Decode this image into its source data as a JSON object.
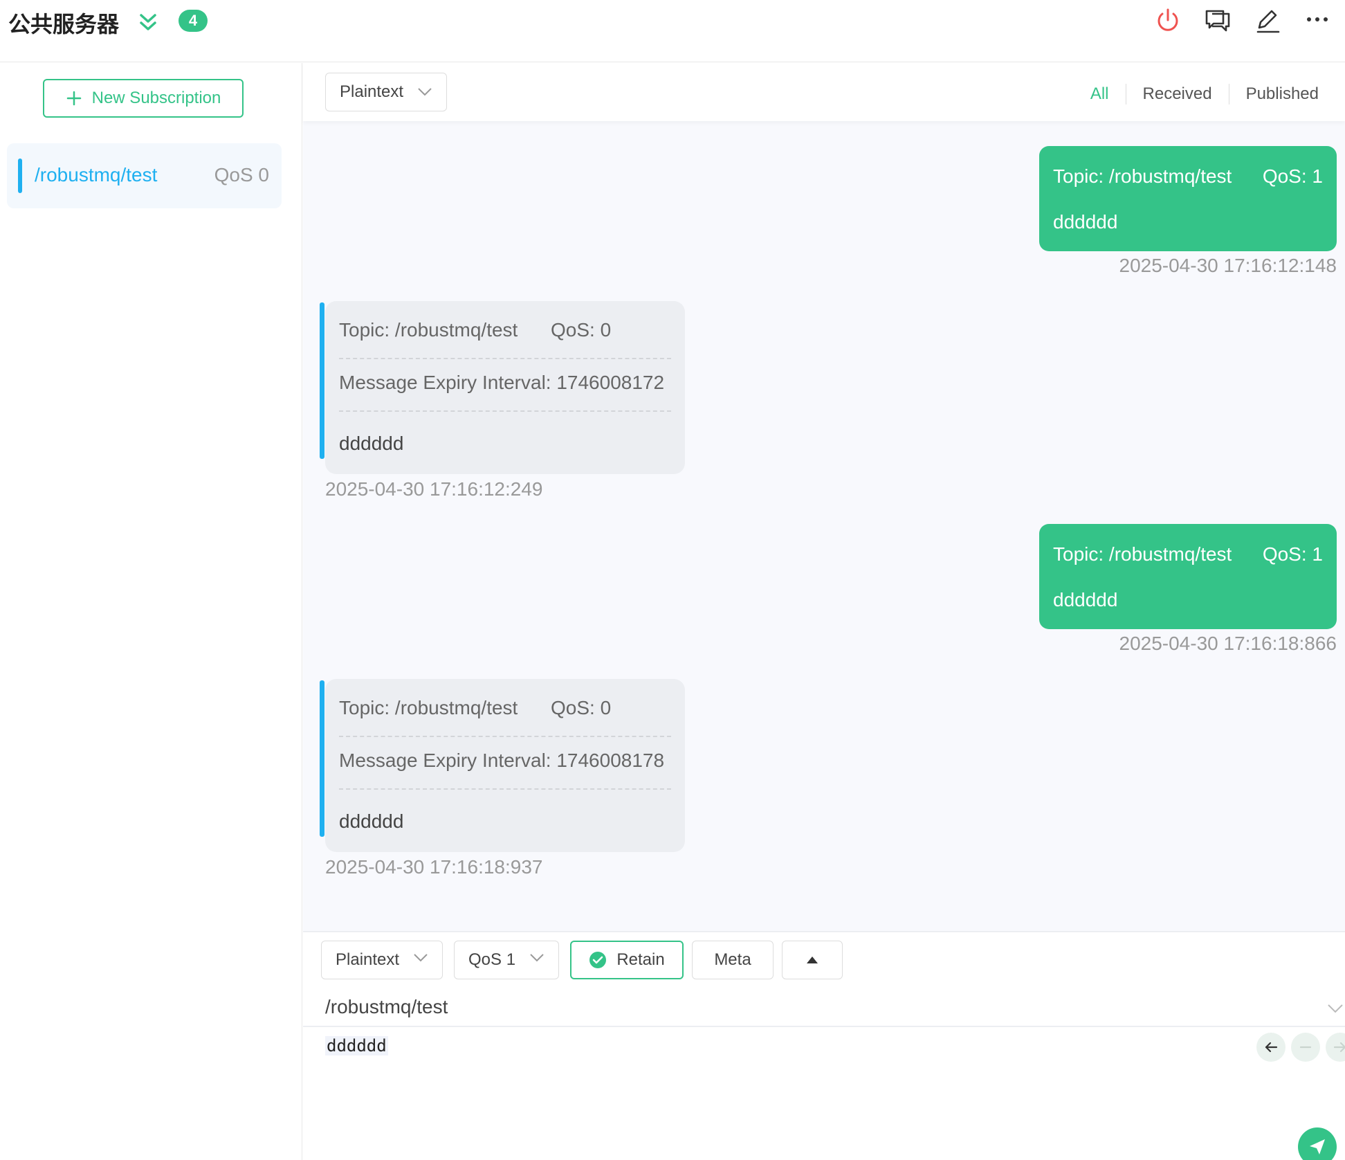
{
  "header": {
    "title": "公共服务器",
    "unread_count": "4",
    "icons": [
      "collapse-double-chevron-icon",
      "power-icon",
      "chat-bubbles-icon",
      "edit-pencil-icon",
      "more-dots-icon"
    ]
  },
  "sidebar": {
    "new_subscription_label": "New Subscription",
    "subscriptions": [
      {
        "topic": "/robustmq/test",
        "qos": "QoS 0",
        "color": "#1fb0f0"
      }
    ]
  },
  "toolbar": {
    "format": "Plaintext",
    "filters": {
      "all": "All",
      "received": "Received",
      "published": "Published"
    },
    "active_filter": "All"
  },
  "messages": [
    {
      "direction": "out",
      "topic": "Topic: /robustmq/test",
      "qos": "QoS: 1",
      "payload": "dddddd",
      "time": "2025-04-30 17:16:12:148"
    },
    {
      "direction": "in",
      "topic": "Topic: /robustmq/test",
      "qos": "QoS: 0",
      "expiry": "Message Expiry Interval: 1746008172",
      "payload": "dddddd",
      "time": "2025-04-30 17:16:12:249"
    },
    {
      "direction": "out",
      "topic": "Topic: /robustmq/test",
      "qos": "QoS: 1",
      "payload": "dddddd",
      "time": "2025-04-30 17:16:18:866"
    },
    {
      "direction": "in",
      "topic": "Topic: /robustmq/test",
      "qos": "QoS: 0",
      "expiry": "Message Expiry Interval: 1746008178",
      "payload": "dddddd",
      "time": "2025-04-30 17:16:18:937"
    }
  ],
  "composer": {
    "format": "Plaintext",
    "qos": "QoS 1",
    "retain_label": "Retain",
    "retain_checked": true,
    "meta_label": "Meta",
    "topic_value": "/robustmq/test",
    "payload_value": "dddddd"
  },
  "colors": {
    "accent": "#34c388",
    "subscription": "#1fb0f0",
    "danger": "#ef5350"
  }
}
